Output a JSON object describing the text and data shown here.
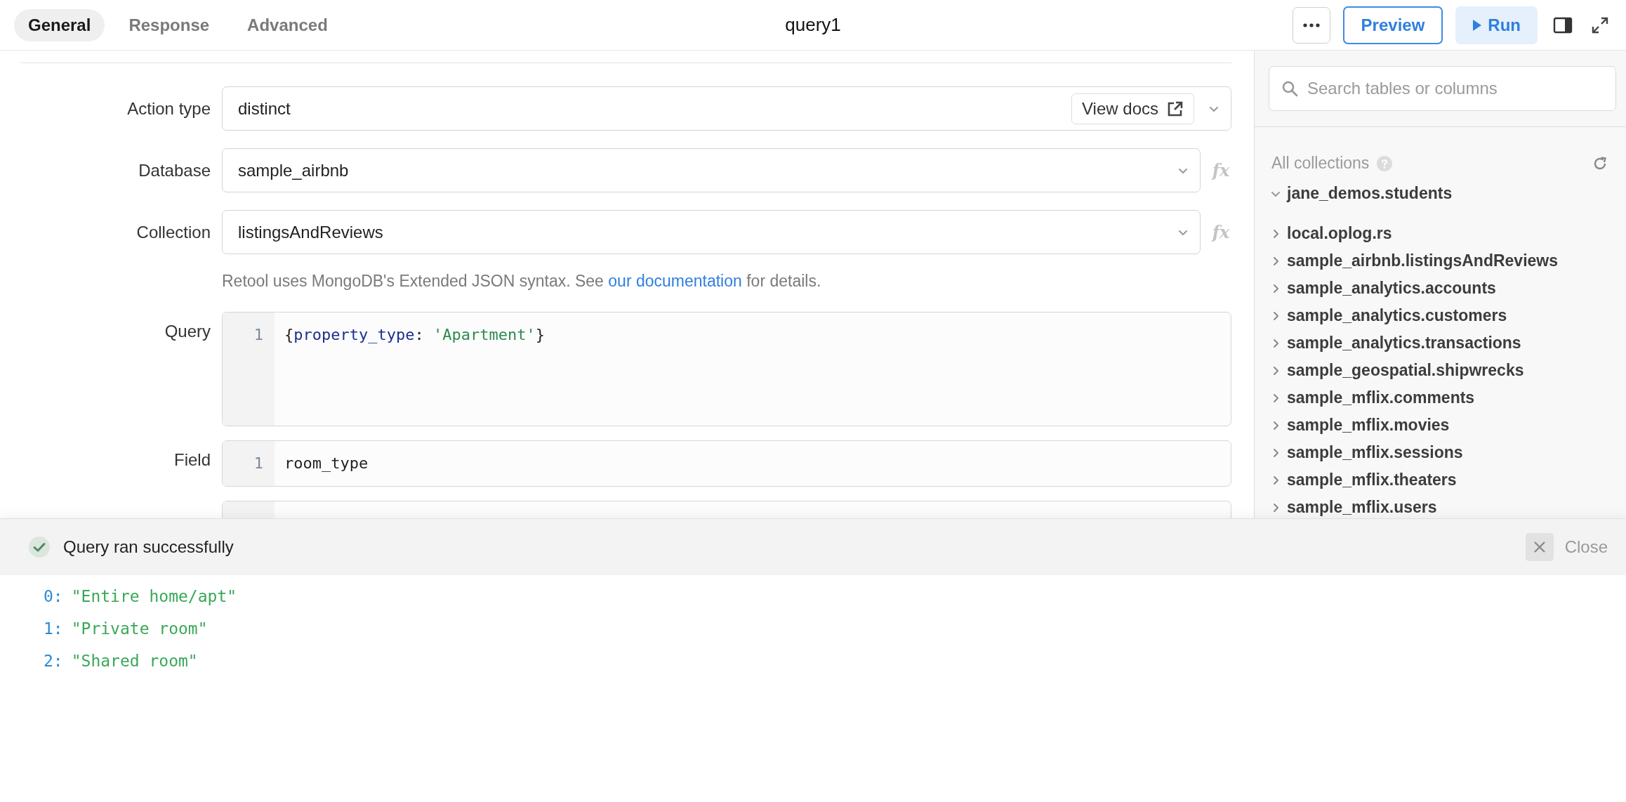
{
  "tabs": [
    {
      "label": "General",
      "selected": true
    },
    {
      "label": "Response",
      "selected": false
    },
    {
      "label": "Advanced",
      "selected": false
    }
  ],
  "title": "query1",
  "toolbar": {
    "preview_button": "Preview",
    "run_button": "Run"
  },
  "form": {
    "fields": [
      {
        "kind": "select-docs",
        "label": "Action type",
        "value": "distinct",
        "docs_button": "View docs"
      },
      {
        "kind": "select-fx",
        "label": "Database",
        "value": "sample_airbnb",
        "fx_button": "fx"
      },
      {
        "kind": "select-fx",
        "label": "Collection",
        "value": "listingsAndReviews",
        "fx_button": "fx"
      }
    ],
    "help": {
      "before": "Retool uses MongoDB's Extended JSON syntax. See",
      "link": "our documentation",
      "after": "for details."
    },
    "editors": [
      {
        "label": "Query",
        "lines": [
          {
            "number": "1",
            "tokens": [
              {
                "kind": "punctuation",
                "text": "{"
              },
              {
                "kind": "key",
                "text": "property_type"
              },
              {
                "kind": "punctuation",
                "text": ": "
              },
              {
                "kind": "string",
                "text": "'Apartment'"
              },
              {
                "kind": "punctuation",
                "text": "}"
              }
            ]
          }
        ]
      },
      {
        "label": "Field",
        "lines": [
          {
            "number": "1",
            "tokens": [
              {
                "kind": "plain",
                "text": "room_type"
              }
            ]
          }
        ]
      }
    ]
  },
  "sidebar": {
    "search_placeholder": "Search tables or columns",
    "heading": "All collections",
    "items": [
      {
        "label": "jane_demos.students",
        "expanded": true
      },
      {
        "label": "local.oplog.rs",
        "expanded": false
      },
      {
        "label": "sample_airbnb.listingsAndReviews",
        "expanded": false
      },
      {
        "label": "sample_analytics.accounts",
        "expanded": false
      },
      {
        "label": "sample_analytics.customers",
        "expanded": false
      },
      {
        "label": "sample_analytics.transactions",
        "expanded": false
      },
      {
        "label": "sample_geospatial.shipwrecks",
        "expanded": false
      },
      {
        "label": "sample_mflix.comments",
        "expanded": false
      },
      {
        "label": "sample_mflix.movies",
        "expanded": false
      },
      {
        "label": "sample_mflix.sessions",
        "expanded": false
      },
      {
        "label": "sample_mflix.theaters",
        "expanded": false
      },
      {
        "label": "sample_mflix.users",
        "expanded": false
      }
    ]
  },
  "results": {
    "status": "Query ran successfully",
    "close_button": "Close",
    "rows": [
      {
        "index": "0:",
        "value": "\"Entire home/apt\""
      },
      {
        "index": "1:",
        "value": "\"Private room\""
      },
      {
        "index": "2:",
        "value": "\"Shared room\""
      }
    ]
  }
}
